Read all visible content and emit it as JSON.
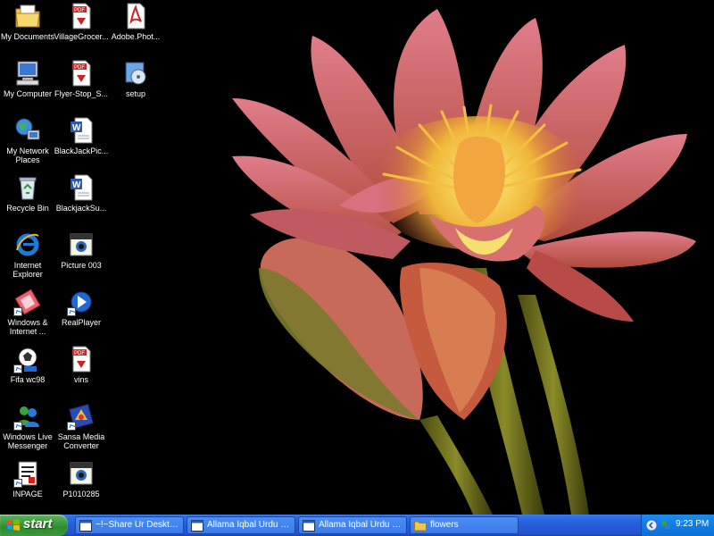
{
  "desktop": {
    "icons": [
      {
        "label": "My Documents",
        "icon": "my-documents-icon"
      },
      {
        "label": "VillageGrocer...",
        "icon": "pdf-file-icon"
      },
      {
        "label": "Adobe.Phot...",
        "icon": "adobe-file-icon"
      },
      {
        "label": "My Computer",
        "icon": "my-computer-icon"
      },
      {
        "label": "Flyer-Stop_S...",
        "icon": "pdf-file-icon"
      },
      {
        "label": "setup",
        "icon": "setup-icon"
      },
      {
        "label": "My Network Places",
        "icon": "network-places-icon"
      },
      {
        "label": "BlackJackPic...",
        "icon": "word-document-icon"
      },
      {
        "label": "Recycle Bin",
        "icon": "recycle-bin-icon"
      },
      {
        "label": "BlackjackSu...",
        "icon": "word-document-icon"
      },
      {
        "label": "Internet Explorer",
        "icon": "internet-explorer-icon"
      },
      {
        "label": "Picture 003",
        "icon": "image-file-icon"
      },
      {
        "label": "Windows & Internet ...",
        "icon": "shortcut-icon"
      },
      {
        "label": "RealPlayer",
        "icon": "realplayer-icon"
      },
      {
        "label": "Fifa wc98",
        "icon": "game-icon"
      },
      {
        "label": "vins",
        "icon": "pdf-file-icon"
      },
      {
        "label": "Windows Live Messenger",
        "icon": "messenger-icon"
      },
      {
        "label": "Sansa Media Converter",
        "icon": "media-converter-icon"
      },
      {
        "label": "INPAGE",
        "icon": "inpage-icon"
      },
      {
        "label": "P1010285",
        "icon": "image-file-icon"
      }
    ]
  },
  "taskbar": {
    "start_label": "start",
    "tasks": [
      {
        "label": "~!~Share Ur Desktop...",
        "icon": "browser-window-icon"
      },
      {
        "label": "Allama Iqbal Urdu Cy...",
        "icon": "browser-window-icon"
      },
      {
        "label": "Allama Iqbal Urdu Cy...",
        "icon": "browser-window-icon"
      },
      {
        "label": "flowers",
        "icon": "folder-icon"
      }
    ],
    "tray": {
      "clock": "9:23 PM"
    }
  },
  "colors": {
    "taskbar": "#245edb",
    "start_button": "#3c9c3c",
    "tray": "#0f7de6"
  }
}
